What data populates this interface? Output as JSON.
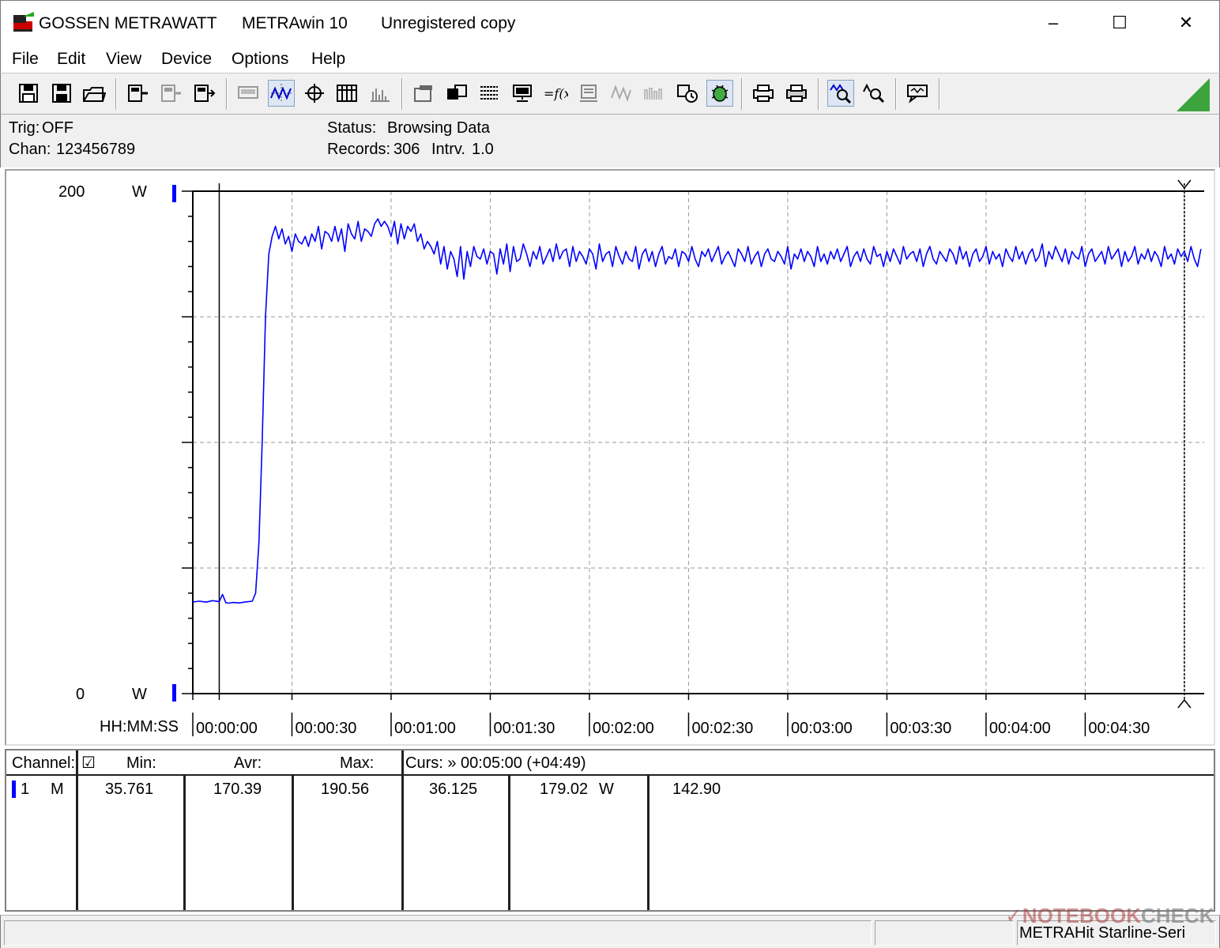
{
  "window": {
    "brand": "GOSSEN METRAWATT",
    "app": "METRAwin 10",
    "license": "Unregistered copy",
    "minimize": "–",
    "maximize": "☐",
    "close": "✕"
  },
  "menu": {
    "file": "File",
    "edit": "Edit",
    "view": "View",
    "device": "Device",
    "options": "Options",
    "help": "Help"
  },
  "toolbar": {
    "icons": [
      "save-icon",
      "save-as-icon",
      "open-folder-icon",
      "device-read-icon",
      "device-disabled-icon",
      "device-write-icon",
      "display-disabled-icon",
      "scope-view-icon",
      "crosshair-icon",
      "table-view-icon",
      "histogram-icon",
      "channel-settings-icon",
      "multichannel-icon",
      "data-list-icon",
      "monitor-icon",
      "function-icon",
      "device-config-icon",
      "wave-disabled-icon",
      "wave-disabled-2-icon",
      "trigger-settings-icon",
      "bug-icon",
      "print-preview-icon",
      "print-icon",
      "zoom-wave-icon",
      "zoom-cursor-icon",
      "comment-icon"
    ]
  },
  "status": {
    "trig_label": "Trig:",
    "trig_value": "OFF",
    "chan_label": "Chan:",
    "chan_value": "123456789",
    "status_label": "Status:",
    "status_value": "Browsing Data",
    "records_label": "Records:",
    "records_value": "306",
    "intrv_label": "Intrv.",
    "intrv_value": "1.0"
  },
  "axes": {
    "y_top": "200",
    "y_bottom": "0",
    "y_unit_top": "W",
    "y_unit_bottom": "W",
    "x_format": "HH:MM:SS"
  },
  "chart_data": {
    "type": "line",
    "ylabel": "W",
    "xlabel": "HH:MM:SS",
    "ylim": [
      0,
      200
    ],
    "xlim_seconds": [
      0,
      306
    ],
    "x_tick_labels": [
      "00:00:00",
      "00:00:30",
      "00:01:00",
      "00:01:30",
      "00:02:00",
      "00:02:30",
      "00:03:00",
      "00:03:30",
      "00:04:00",
      "00:04:30"
    ],
    "grid": true,
    "series": [
      {
        "color": "#0000ff",
        "x_seconds": [
          0,
          2,
          4,
          6,
          8,
          9,
          10,
          11,
          12,
          14,
          16,
          18,
          19,
          20,
          21,
          22,
          23,
          24,
          25,
          26,
          27,
          28,
          29,
          30,
          31,
          32,
          33,
          34,
          35,
          36,
          37,
          38,
          39,
          40,
          41,
          42,
          43,
          44,
          45,
          46,
          47,
          48,
          49,
          50,
          51,
          52,
          53,
          54,
          55,
          56,
          57,
          58,
          59,
          60,
          61,
          62,
          63,
          64,
          65,
          66,
          67,
          68,
          69,
          70,
          71,
          72,
          73,
          74,
          75,
          76,
          77,
          78,
          79,
          80,
          81,
          82,
          83,
          84,
          85,
          86,
          87,
          88,
          89,
          90,
          91,
          92,
          93,
          94,
          95,
          96,
          97,
          98,
          99,
          100,
          101,
          102,
          103,
          104,
          105,
          106,
          107,
          108,
          109,
          110,
          111,
          112,
          113,
          114,
          115,
          116,
          117,
          118,
          119,
          120,
          121,
          122,
          123,
          124,
          125,
          126,
          127,
          128,
          129,
          130,
          131,
          132,
          133,
          134,
          135,
          136,
          137,
          138,
          139,
          140,
          141,
          142,
          143,
          144,
          145,
          146,
          147,
          148,
          149,
          150,
          151,
          152,
          153,
          154,
          155,
          156,
          157,
          158,
          159,
          160,
          161,
          162,
          163,
          164,
          165,
          166,
          167,
          168,
          169,
          170,
          171,
          172,
          173,
          174,
          175,
          176,
          177,
          178,
          179,
          180,
          181,
          182,
          183,
          184,
          185,
          186,
          187,
          188,
          189,
          190,
          191,
          192,
          193,
          194,
          195,
          196,
          197,
          198,
          199,
          200,
          201,
          202,
          203,
          204,
          205,
          206,
          207,
          208,
          209,
          210,
          211,
          212,
          213,
          214,
          215,
          216,
          217,
          218,
          219,
          220,
          221,
          222,
          223,
          224,
          225,
          226,
          227,
          228,
          229,
          230,
          231,
          232,
          233,
          234,
          235,
          236,
          237,
          238,
          239,
          240,
          241,
          242,
          243,
          244,
          245,
          246,
          247,
          248,
          249,
          250,
          251,
          252,
          253,
          254,
          255,
          256,
          257,
          258,
          259,
          260,
          261,
          262,
          263,
          264,
          265,
          266,
          267,
          268,
          269,
          270,
          271,
          272,
          273,
          274,
          275,
          276,
          277,
          278,
          279,
          280,
          281,
          282,
          283,
          284,
          285,
          286,
          287,
          288,
          289,
          290,
          291,
          292,
          293,
          294,
          295,
          296,
          297,
          298,
          299,
          300,
          301,
          302,
          303,
          304,
          305
        ],
        "values_w": [
          36.5,
          36.8,
          36.4,
          37.0,
          36.6,
          39.5,
          36.2,
          36.0,
          36.3,
          36.1,
          36.5,
          36.8,
          40,
          60,
          100,
          150,
          175,
          182,
          186,
          181,
          185,
          179,
          182,
          176,
          183,
          180,
          179,
          182,
          178,
          183,
          180,
          186,
          177,
          184,
          183,
          180,
          186,
          180,
          185,
          176,
          187,
          183,
          181,
          188,
          180,
          185,
          184,
          182,
          187,
          189,
          186,
          188,
          186,
          182,
          188,
          179,
          187,
          181,
          186,
          184,
          187,
          180,
          183,
          177,
          180,
          178,
          175,
          180,
          171,
          178,
          169,
          176,
          173,
          166,
          178,
          165,
          176,
          170,
          178,
          174,
          173,
          177,
          171,
          176,
          175,
          167,
          177,
          171,
          179,
          168,
          178,
          172,
          173,
          179,
          175,
          170,
          176,
          173,
          178,
          171,
          174,
          177,
          172,
          179,
          173,
          176,
          177,
          170,
          178,
          172,
          176,
          174,
          171,
          177,
          175,
          169,
          179,
          172,
          175,
          176,
          170,
          178,
          174,
          171,
          176,
          173,
          172,
          178,
          169,
          175,
          177,
          172,
          176,
          170,
          175,
          178,
          171,
          174,
          173,
          177,
          170,
          176,
          175,
          172,
          178,
          173,
          170,
          176,
          174,
          177,
          172,
          175,
          178,
          171,
          174,
          176,
          173,
          170,
          177,
          175,
          172,
          178,
          171,
          174,
          176,
          170,
          175,
          177,
          173,
          172,
          176,
          174,
          171,
          178,
          169,
          175,
          173,
          177,
          172,
          176,
          174,
          170,
          178,
          172,
          175,
          171,
          176,
          173,
          177,
          172,
          175,
          178,
          170,
          174,
          176,
          172,
          177,
          173,
          171,
          178,
          174,
          175,
          170,
          176,
          172,
          177,
          174,
          171,
          178,
          173,
          175,
          176,
          172,
          177,
          170,
          175,
          178,
          173,
          171,
          176,
          174,
          172,
          177,
          175,
          171,
          178,
          173,
          176,
          170,
          175,
          177,
          172,
          174,
          178,
          171,
          176,
          173,
          175,
          170,
          177,
          174,
          172,
          178,
          173,
          176,
          171,
          175,
          177,
          172,
          174,
          179,
          170,
          176,
          173,
          178,
          175,
          172,
          177,
          171,
          176,
          174,
          173,
          178,
          170,
          175,
          177,
          172,
          174,
          176,
          171,
          178,
          173,
          175,
          177,
          170,
          176,
          172,
          174,
          178,
          171,
          175,
          173,
          177,
          172,
          176,
          174,
          170,
          178,
          173,
          175,
          171,
          177,
          174,
          176,
          172,
          178,
          173,
          170,
          177,
          175,
          172,
          176,
          174,
          171,
          179,
          173,
          175,
          170,
          177,
          172,
          176,
          174,
          178,
          171,
          175,
          173,
          176,
          172
        ]
      }
    ]
  },
  "table": {
    "header": {
      "channel": "Channel:",
      "check": "☑",
      "min": "Min:",
      "avr": "Avr:",
      "max": "Max:",
      "curs": "Curs: » 00:05:00 (+04:49)"
    },
    "row": {
      "num": "1",
      "mode": "M",
      "min": "35.761",
      "avr": "170.39",
      "max": "190.56",
      "curs_a": "36.125",
      "curs_b": "179.02",
      "unit": "W",
      "delta": "142.90"
    }
  },
  "footer": {
    "device": "METRAHit Starline-Seri",
    "watermark_prefix": "NOTEBOOK",
    "watermark_suffix": "CHECK"
  },
  "colors": {
    "trace": "#0000ff",
    "grid": "#9a9a9a",
    "axis": "#000000",
    "chrome": "#f0f0f0"
  }
}
